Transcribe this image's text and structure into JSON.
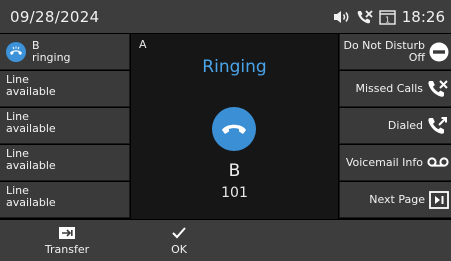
{
  "status_bar": {
    "date": "09/28/2024",
    "time": "18:26",
    "icons": [
      "speaker-icon",
      "missed-call-icon",
      "voicemail-box-icon"
    ],
    "voicemail_count": "1"
  },
  "line_keys": [
    {
      "name": "B",
      "status": "ringing",
      "icon": "ringing-handset-icon"
    },
    {
      "line1": "Line",
      "line2": "available"
    },
    {
      "line1": "Line",
      "line2": "available"
    },
    {
      "line1": "Line",
      "line2": "available"
    },
    {
      "line1": "Line",
      "line2": "available"
    }
  ],
  "call": {
    "id": "A",
    "state": "Ringing",
    "party_name": "B",
    "party_number": "101",
    "accent": "#4aa4ea"
  },
  "function_keys": [
    {
      "line1": "Do Not Disturb",
      "line2": "Off",
      "icon": "dnd-icon"
    },
    {
      "label": "Missed Calls",
      "icon": "missed-calls-icon"
    },
    {
      "label": "Dialed",
      "icon": "dialed-icon"
    },
    {
      "label": "Voicemail Info",
      "icon": "voicemail-icon"
    },
    {
      "label": "Next Page",
      "icon": "next-page-icon"
    }
  ],
  "softkeys": {
    "transfer": {
      "label": "Transfer",
      "icon": "transfer-icon"
    },
    "ok": {
      "label": "OK",
      "icon": "checkmark-icon"
    }
  }
}
